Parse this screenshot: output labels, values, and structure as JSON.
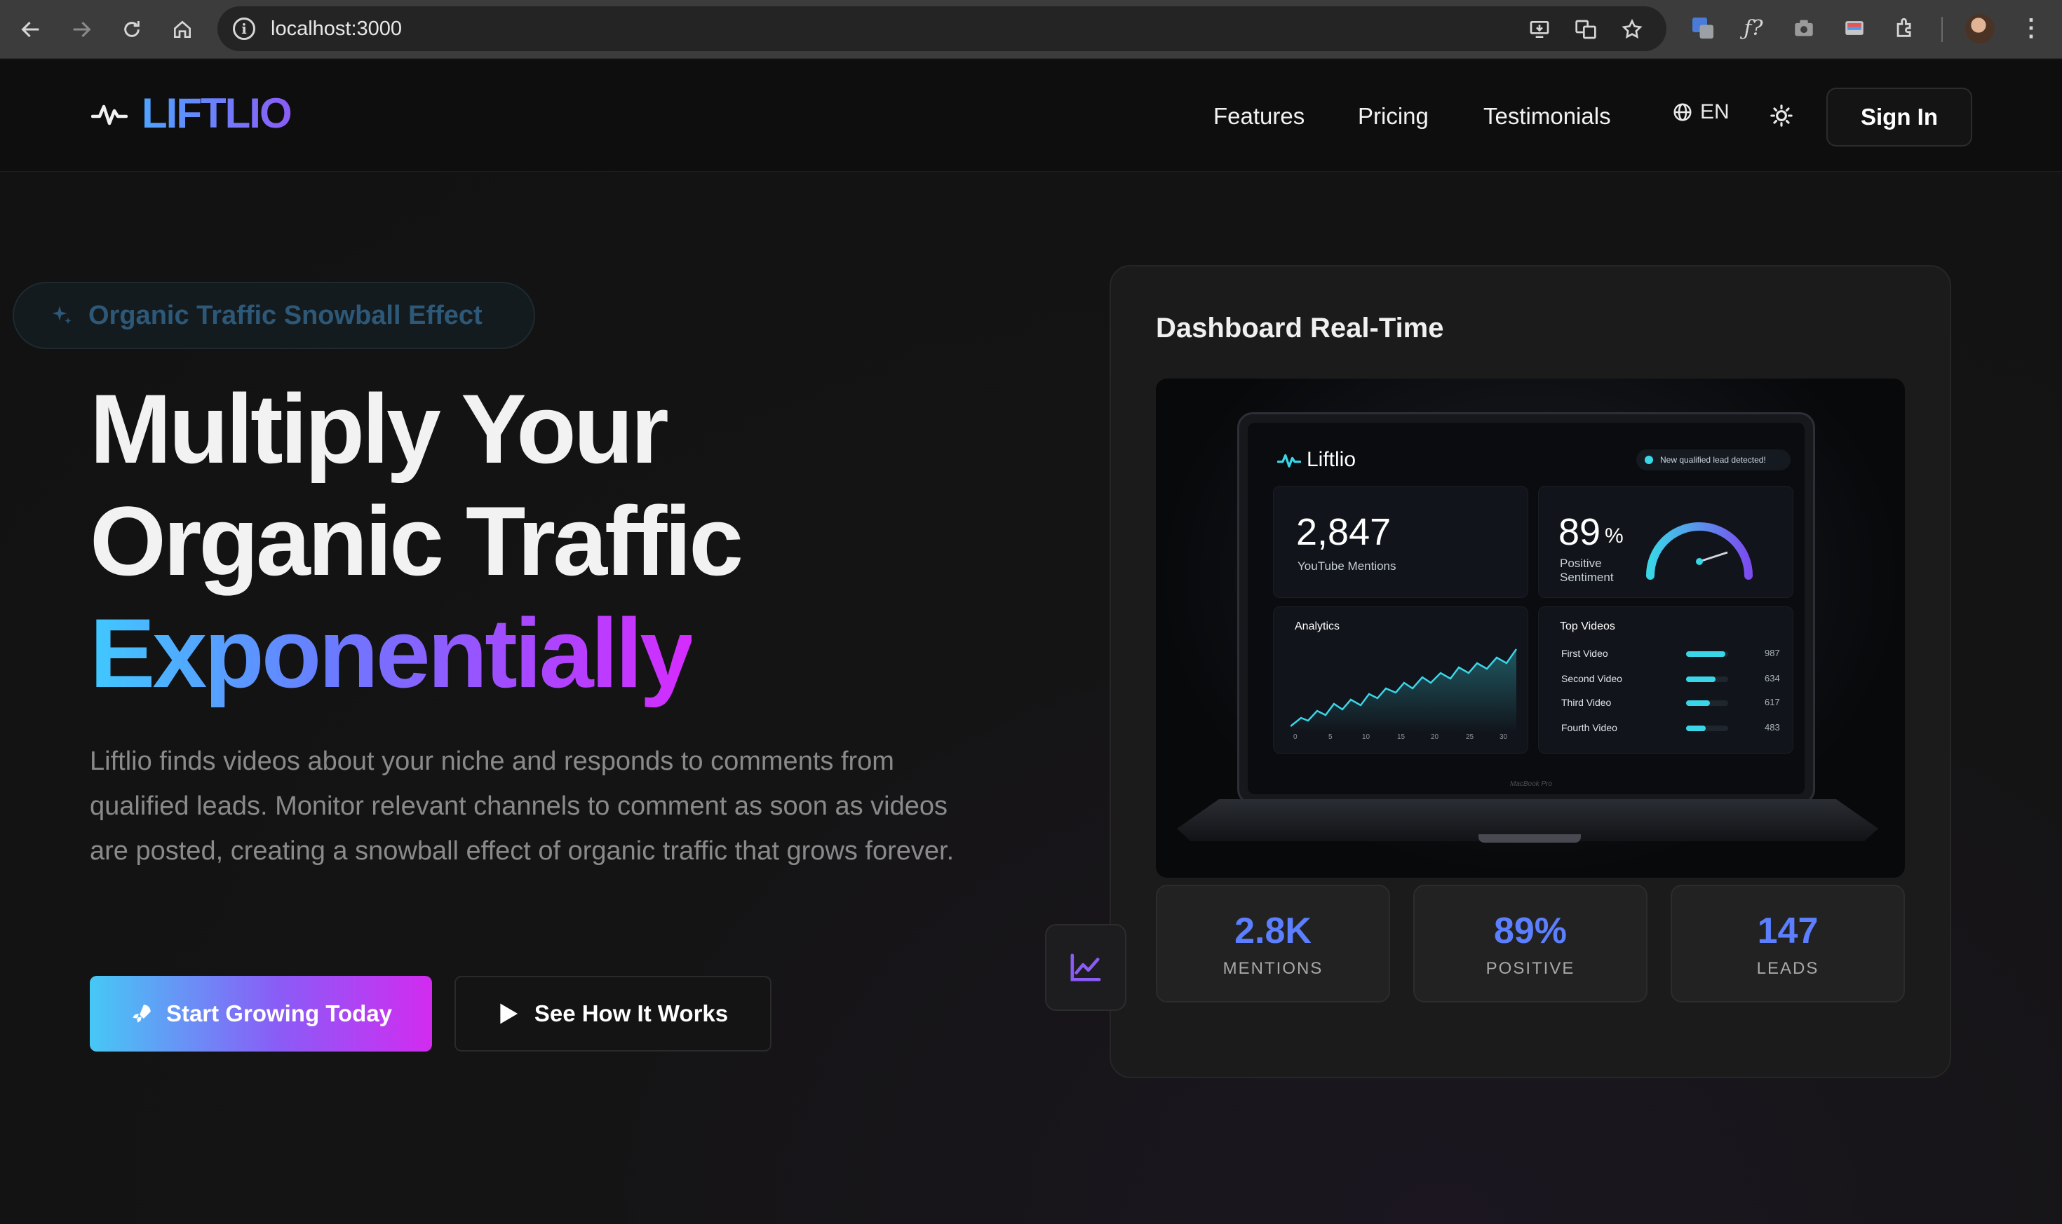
{
  "browser": {
    "url": "localhost:3000"
  },
  "header": {
    "logo_text": "LIFTLIO",
    "nav": [
      "Features",
      "Pricing",
      "Testimonials"
    ],
    "lang": "EN",
    "signin": "Sign In"
  },
  "hero": {
    "badge": "Organic Traffic Snowball Effect",
    "title_line1": "Multiply Your",
    "title_line2": "Organic Traffic",
    "title_line3": "Exponentially",
    "description": "Liftlio finds videos about your niche and responds to comments from qualified leads. Monitor relevant channels to comment as soon as videos are posted, creating a snowball effect of organic traffic that grows forever.",
    "cta_primary": "Start Growing Today",
    "cta_secondary": "See How It Works"
  },
  "dashboard": {
    "title": "Dashboard Real-Time",
    "screen": {
      "brand": "Liftlio",
      "notification": "New qualified lead detected!",
      "mentions_value": "2,847",
      "mentions_label": "YouTube Mentions",
      "sentiment_value": "89",
      "sentiment_unit": "%",
      "sentiment_label_1": "Positive",
      "sentiment_label_2": "Sentiment",
      "sentiment_gauge_fraction": 0.89,
      "analytics_title": "Analytics",
      "analytics_ticks": [
        "0",
        "5",
        "10",
        "15",
        "20",
        "25",
        "30"
      ],
      "top_videos_title": "Top Videos",
      "top_videos": [
        {
          "name": "First Video",
          "value": "987"
        },
        {
          "name": "Second Video",
          "value": "634"
        },
        {
          "name": "Third Video",
          "value": "617"
        },
        {
          "name": "Fourth Video",
          "value": "483"
        }
      ],
      "laptop_label": "MacBook Pro"
    },
    "stats": [
      {
        "value": "2.8K",
        "label": "MENTIONS"
      },
      {
        "value": "89%",
        "label": "POSITIVE"
      },
      {
        "value": "147",
        "label": "LEADS"
      }
    ]
  },
  "colors": {
    "accent_blue": "#5b7fff",
    "accent_cyan": "#3ad6e8",
    "accent_purple": "#a24bff",
    "accent_magenta": "#d52cff"
  },
  "icons": [
    "back-icon",
    "forward-icon",
    "reload-icon",
    "home-icon",
    "site-info-icon",
    "install-icon",
    "translate-icon",
    "bookmark-star-icon",
    "extension-icon",
    "profile-avatar",
    "pulse-logo-icon",
    "globe-icon",
    "sun-icon",
    "sparkle-icon",
    "rocket-icon",
    "play-icon",
    "trending-chart-icon"
  ]
}
